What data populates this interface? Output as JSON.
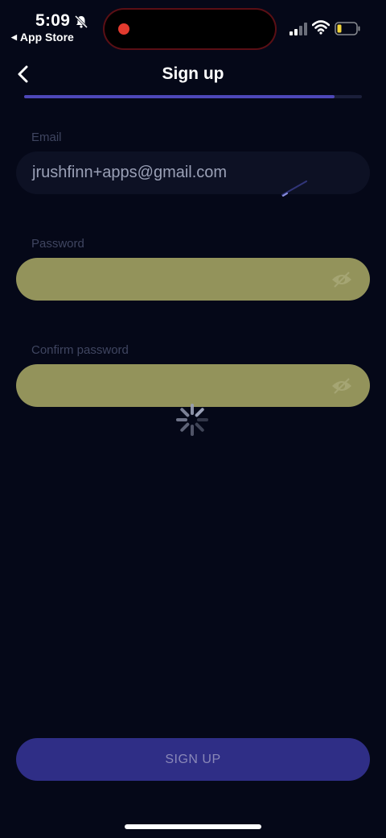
{
  "status_bar": {
    "time": "5:09",
    "back_app": "App Store",
    "icons": [
      "bell-muted-icon",
      "signal-icon",
      "wifi-icon",
      "battery-icon"
    ],
    "recording_color": "#e23a2e"
  },
  "nav": {
    "title": "Sign up",
    "back_icon": "chevron-left-icon"
  },
  "progress": {
    "fraction": 0.92,
    "color": "#4d47b8"
  },
  "form": {
    "email": {
      "label": "Email",
      "value": "jrushfinn+apps@gmail.com"
    },
    "password": {
      "label": "Password",
      "fill_color": "#93935b",
      "icon": "eye-icon"
    },
    "confirm_password": {
      "label": "Confirm password",
      "fill_color": "#93935b",
      "icon": "eye-icon"
    }
  },
  "loading": {
    "icon": "spinner-icon"
  },
  "submit": {
    "label": "SIGN UP",
    "color": "#2f2e86"
  }
}
